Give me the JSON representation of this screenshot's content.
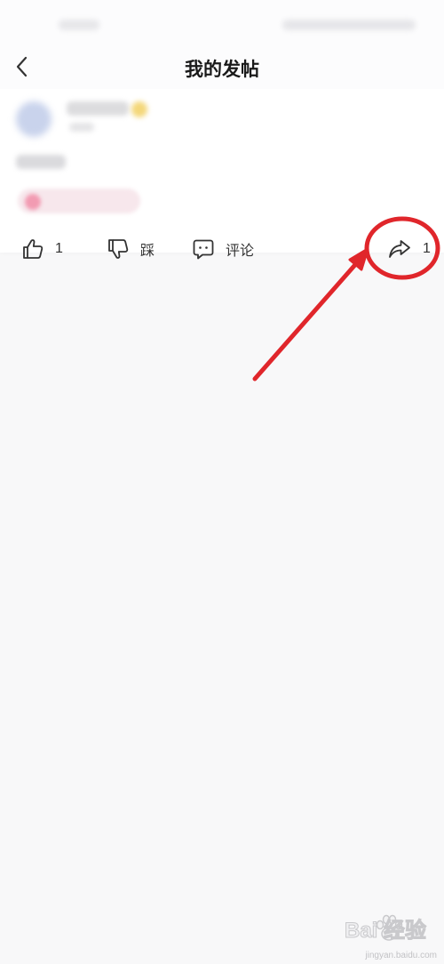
{
  "header": {
    "title": "我的发帖",
    "back_icon": "chevron-left-icon"
  },
  "post": {
    "actions": {
      "like": {
        "icon": "thumbs-up-icon",
        "count": "1"
      },
      "dislike": {
        "icon": "thumbs-down-icon",
        "label": "踩"
      },
      "comment": {
        "icon": "comment-bubble-icon",
        "label": "评论"
      },
      "share": {
        "icon": "share-arrow-icon",
        "count": "1"
      }
    }
  },
  "annotation": {
    "highlight_color": "#e0262b",
    "target": "share-button"
  },
  "watermark": {
    "brand": "Bai 经验",
    "url": "jingyan.baidu.com"
  },
  "colors": {
    "background": "#f8f8f9",
    "card": "#ffffff",
    "text": "#333333",
    "title": "#1a1a1a"
  }
}
